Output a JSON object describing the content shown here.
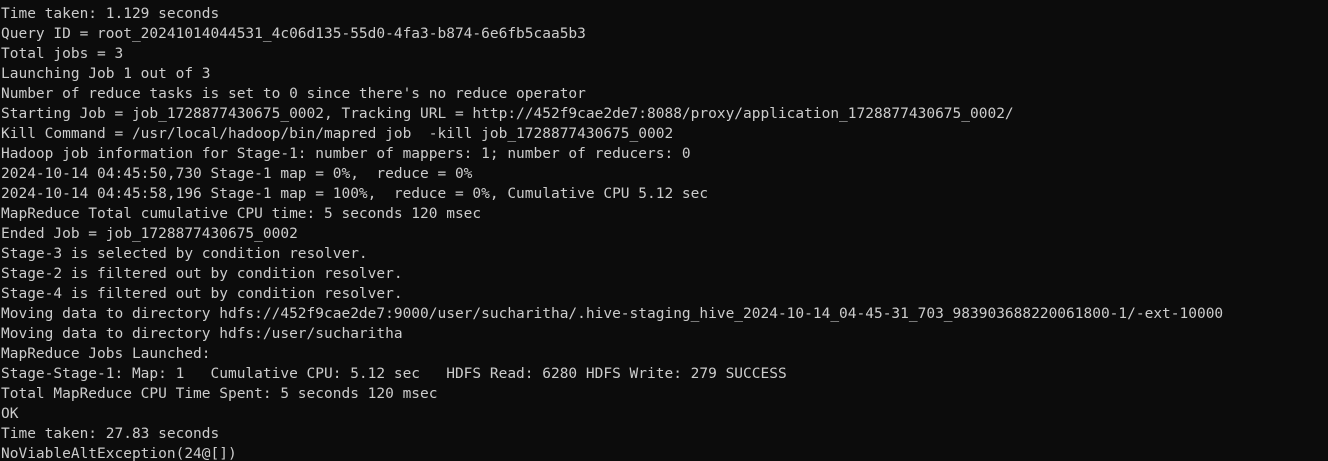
{
  "terminal": {
    "background": "#0c0c0c",
    "foreground": "#cccccc",
    "lines": [
      "Time taken: 1.129 seconds",
      "Query ID = root_20241014044531_4c06d135-55d0-4fa3-b874-6e6fb5caa5b3",
      "Total jobs = 3",
      "Launching Job 1 out of 3",
      "Number of reduce tasks is set to 0 since there's no reduce operator",
      "Starting Job = job_1728877430675_0002, Tracking URL = http://452f9cae2de7:8088/proxy/application_1728877430675_0002/",
      "Kill Command = /usr/local/hadoop/bin/mapred job  -kill job_1728877430675_0002",
      "Hadoop job information for Stage-1: number of mappers: 1; number of reducers: 0",
      "2024-10-14 04:45:50,730 Stage-1 map = 0%,  reduce = 0%",
      "2024-10-14 04:45:58,196 Stage-1 map = 100%,  reduce = 0%, Cumulative CPU 5.12 sec",
      "MapReduce Total cumulative CPU time: 5 seconds 120 msec",
      "Ended Job = job_1728877430675_0002",
      "Stage-3 is selected by condition resolver.",
      "Stage-2 is filtered out by condition resolver.",
      "Stage-4 is filtered out by condition resolver.",
      "Moving data to directory hdfs://452f9cae2de7:9000/user/sucharitha/.hive-staging_hive_2024-10-14_04-45-31_703_983903688220061800-1/-ext-10000",
      "Moving data to directory hdfs:/user/sucharitha",
      "MapReduce Jobs Launched:",
      "Stage-Stage-1: Map: 1   Cumulative CPU: 5.12 sec   HDFS Read: 6280 HDFS Write: 279 SUCCESS",
      "Total MapReduce CPU Time Spent: 5 seconds 120 msec",
      "OK",
      "Time taken: 27.83 seconds",
      "NoViableAltException(24@[])"
    ]
  }
}
